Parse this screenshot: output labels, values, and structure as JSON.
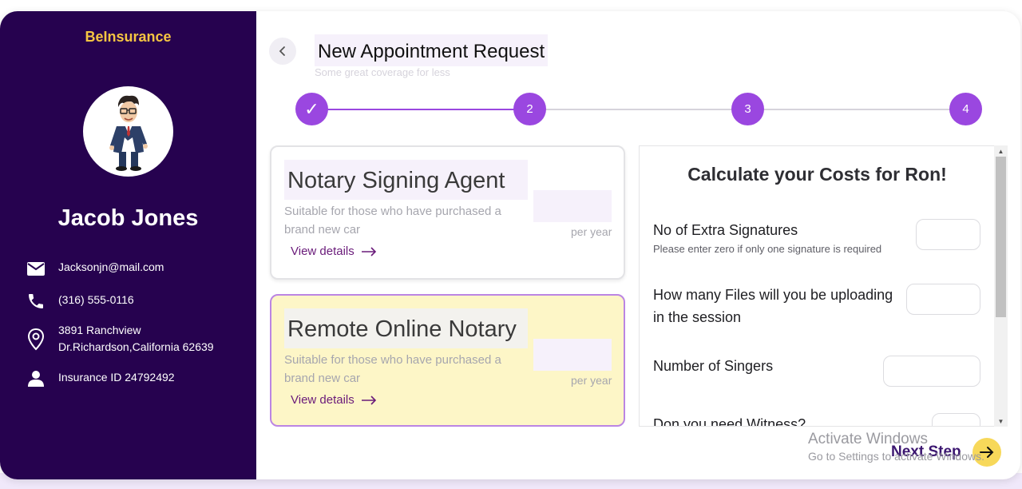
{
  "sidebar": {
    "brand": "BeInsurance",
    "user_name": "Jacob Jones",
    "email": "Jacksonjn@mail.com",
    "phone": "(316) 555-0116",
    "address_line1": "3891 Ranchview",
    "address_line2": "Dr.Richardson,California 62639",
    "insurance_id": "Insurance ID 24792492"
  },
  "header": {
    "title": "New Appointment Request",
    "subtitle": "Some great coverage for less"
  },
  "stepper": {
    "steps": [
      {
        "label": "✓",
        "state": "completed"
      },
      {
        "label": "2",
        "state": "current"
      },
      {
        "label": "3",
        "state": "upcoming"
      },
      {
        "label": "4",
        "state": "upcoming"
      }
    ]
  },
  "plans": [
    {
      "title": "Notary Signing Agent",
      "description": "Suitable for those who have purchased a brand new car",
      "period": "per year",
      "link": "View details",
      "selected": false
    },
    {
      "title": "Remote Online Notary",
      "description": "Suitable for those who have purchased a brand new car",
      "period": "per year",
      "link": "View details",
      "selected": true
    }
  ],
  "calculator": {
    "title": "Calculate your Costs for Ron!",
    "fields": [
      {
        "label": "No of Extra Signatures",
        "hint": "Please enter zero if only one signature is required",
        "value": ""
      },
      {
        "label": "How many Files will you be uploading in the session",
        "value": ""
      },
      {
        "label": "Number of Singers",
        "value": ""
      },
      {
        "label": "Don you need Witness?",
        "value": ""
      }
    ]
  },
  "footer": {
    "next_label": "Next Step"
  },
  "watermark": {
    "line1": "Activate Windows",
    "line2": "Go to Settings to activate Windows."
  },
  "colors": {
    "sidebar_bg": "#26024f",
    "brand": "#f5c542",
    "accent": "#9a47e0",
    "selected_card_bg": "#fdf6c7",
    "next_button": "#f7d85a"
  }
}
